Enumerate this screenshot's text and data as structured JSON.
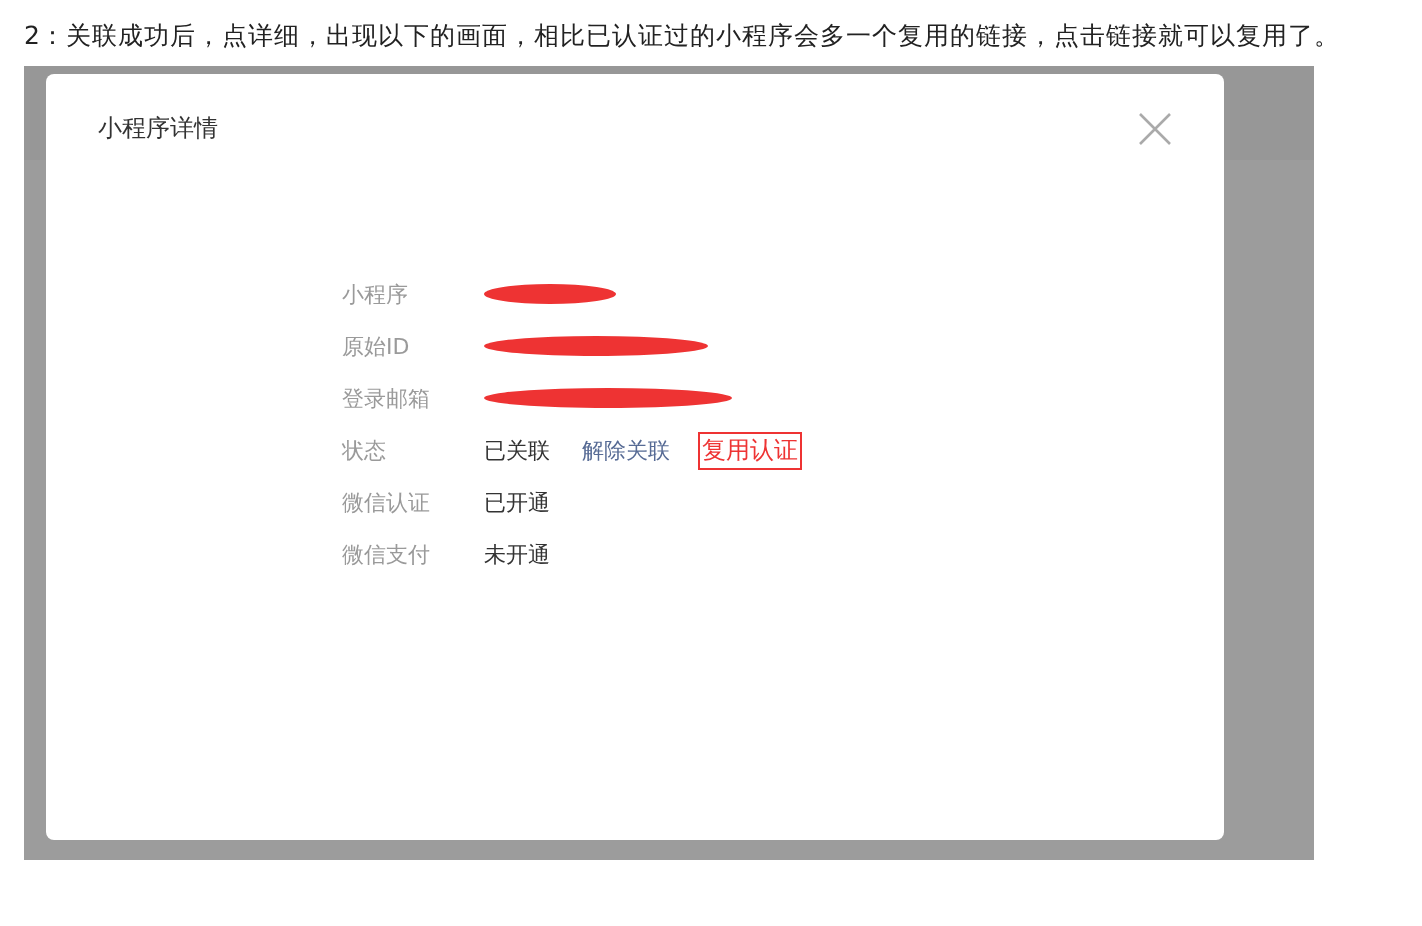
{
  "caption": "2：关联成功后，点详细，出现以下的画面，相比已认证过的小程序会多一个复用的链接，点击链接就可以复用了。",
  "dialog": {
    "title": "小程序详情",
    "rows": [
      {
        "label": "小程序",
        "kind": "redacted"
      },
      {
        "label": "原始ID",
        "kind": "redacted"
      },
      {
        "label": "登录邮箱",
        "kind": "redacted"
      },
      {
        "label": "状态",
        "kind": "status",
        "value": "已关联",
        "links": [
          {
            "text": "解除关联",
            "highlighted": false
          },
          {
            "text": "复用认证",
            "highlighted": true
          }
        ]
      },
      {
        "label": "微信认证",
        "kind": "text",
        "value": "已开通"
      },
      {
        "label": "微信支付",
        "kind": "text",
        "value": "未开通"
      }
    ]
  }
}
